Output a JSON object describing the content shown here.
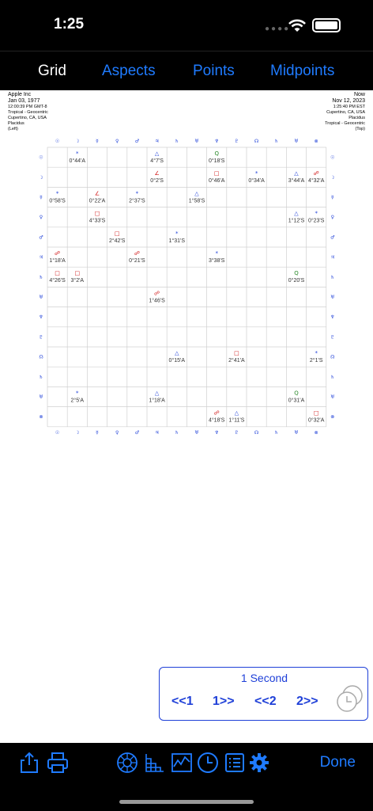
{
  "status": {
    "time": "1:25"
  },
  "tabs": [
    {
      "label": "Grid",
      "active": true
    },
    {
      "label": "Aspects",
      "active": false
    },
    {
      "label": "Points",
      "active": false
    },
    {
      "label": "Midpoints",
      "active": false
    }
  ],
  "left_chart": {
    "name": "Apple Inc",
    "date": "Jan 03, 1977",
    "time": "12:00:39 PM GMT-8",
    "zodiac": "Tropical - Geocentric",
    "location": "Cupertino, CA, USA",
    "houses": "Placidus",
    "side": "(Left)"
  },
  "right_chart": {
    "name": "Now",
    "date": "Nov 12, 2023",
    "time": "1:25:40 PM EST",
    "location": "Cupertino, CA, USA",
    "houses": "Placidus",
    "zodiac": "Tropical - Geocentric",
    "side": "(Top)"
  },
  "planets": [
    "☉",
    "☽",
    "☿",
    "♀",
    "♂",
    "♃",
    "♄",
    "♅",
    "♆",
    "♇",
    "☊",
    "♄",
    "♅",
    "⊗"
  ],
  "grid_cells": [
    {
      "row": 0,
      "col": 1,
      "symbol": "*",
      "color": "#1f40d8",
      "value": "0°44'A"
    },
    {
      "row": 0,
      "col": 5,
      "symbol": "△",
      "color": "#1f40d8",
      "value": "4°7'S"
    },
    {
      "row": 0,
      "col": 8,
      "symbol": "Q",
      "color": "#2a8a2a",
      "value": "0°18'S"
    },
    {
      "row": 1,
      "col": 5,
      "symbol": "∠",
      "color": "#d01010",
      "value": "0°2'S"
    },
    {
      "row": 1,
      "col": 8,
      "symbol": "□",
      "color": "#d01010",
      "value": "0°46'A"
    },
    {
      "row": 1,
      "col": 10,
      "symbol": "*",
      "color": "#1f40d8",
      "value": "0°34'A"
    },
    {
      "row": 1,
      "col": 12,
      "symbol": "△",
      "color": "#1f40d8",
      "value": "3°44'A"
    },
    {
      "row": 1,
      "col": 13,
      "symbol": "☍",
      "color": "#d01010",
      "value": "4°32'A"
    },
    {
      "row": 2,
      "col": 0,
      "symbol": "*",
      "color": "#1f40d8",
      "value": "0°58'S"
    },
    {
      "row": 2,
      "col": 2,
      "symbol": "∠",
      "color": "#d01010",
      "value": "0°22'A"
    },
    {
      "row": 2,
      "col": 4,
      "symbol": "*",
      "color": "#1f40d8",
      "value": "2°37'S"
    },
    {
      "row": 2,
      "col": 7,
      "symbol": "△",
      "color": "#1f40d8",
      "value": "1°58'S"
    },
    {
      "row": 3,
      "col": 2,
      "symbol": "□",
      "color": "#d01010",
      "value": "4°33'S"
    },
    {
      "row": 3,
      "col": 12,
      "symbol": "△",
      "color": "#1f40d8",
      "value": "1°12'S"
    },
    {
      "row": 3,
      "col": 13,
      "symbol": "*",
      "color": "#1f40d8",
      "value": "0°23'S"
    },
    {
      "row": 4,
      "col": 3,
      "symbol": "□",
      "color": "#d01010",
      "value": "2°42'S"
    },
    {
      "row": 4,
      "col": 6,
      "symbol": "*",
      "color": "#1f40d8",
      "value": "1°31'S"
    },
    {
      "row": 5,
      "col": 0,
      "symbol": "☍",
      "color": "#d01010",
      "value": "1°18'A"
    },
    {
      "row": 5,
      "col": 4,
      "symbol": "☍",
      "color": "#d01010",
      "value": "0°21'S"
    },
    {
      "row": 5,
      "col": 8,
      "symbol": "*",
      "color": "#1f40d8",
      "value": "3°38'S"
    },
    {
      "row": 6,
      "col": 0,
      "symbol": "□",
      "color": "#d01010",
      "value": "4°26'S"
    },
    {
      "row": 6,
      "col": 1,
      "symbol": "□",
      "color": "#d01010",
      "value": "3°2'A"
    },
    {
      "row": 6,
      "col": 12,
      "symbol": "Q",
      "color": "#2a8a2a",
      "value": "0°20'S"
    },
    {
      "row": 7,
      "col": 5,
      "symbol": "☍",
      "color": "#d01010",
      "value": "1°46'S"
    },
    {
      "row": 10,
      "col": 6,
      "symbol": "△",
      "color": "#1f40d8",
      "value": "0°15'A"
    },
    {
      "row": 10,
      "col": 9,
      "symbol": "□",
      "color": "#d01010",
      "value": "2°41'A"
    },
    {
      "row": 10,
      "col": 13,
      "symbol": "*",
      "color": "#1f40d8",
      "value": "2°1'S"
    },
    {
      "row": 12,
      "col": 1,
      "symbol": "*",
      "color": "#1f40d8",
      "value": "2°5'A"
    },
    {
      "row": 12,
      "col": 5,
      "symbol": "△",
      "color": "#1f40d8",
      "value": "1°18'A"
    },
    {
      "row": 12,
      "col": 12,
      "symbol": "Q",
      "color": "#2a8a2a",
      "value": "0°31'A"
    },
    {
      "row": 13,
      "col": 8,
      "symbol": "☍",
      "color": "#d01010",
      "value": "4°18'S"
    },
    {
      "row": 13,
      "col": 9,
      "symbol": "△",
      "color": "#1f40d8",
      "value": "1°11'S"
    },
    {
      "row": 13,
      "col": 13,
      "symbol": "□",
      "color": "#d01010",
      "value": "0°32'A"
    }
  ],
  "controls": {
    "speed": "1 Second",
    "back1": "<<1",
    "fwd1": "1>>",
    "back2": "<<2",
    "fwd2": "2>>"
  },
  "toolbar": {
    "done": "Done"
  },
  "colors": {
    "accent": "#1f7bff",
    "grid_accent": "#1f40d8",
    "red": "#d01010",
    "green": "#2a8a2a"
  }
}
